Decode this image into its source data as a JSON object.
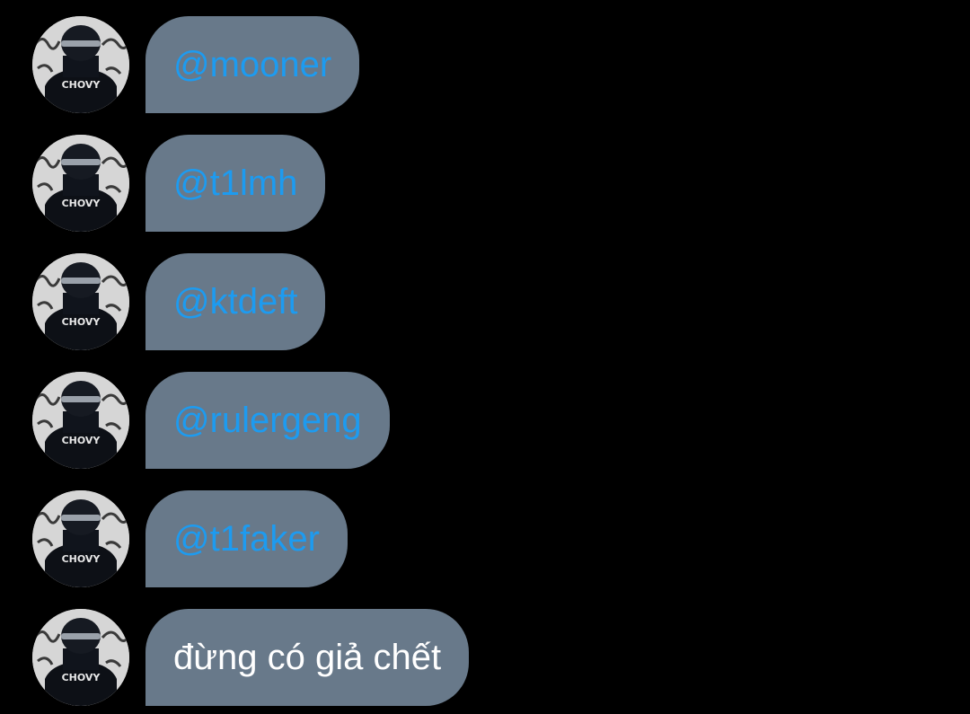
{
  "conversation": {
    "messages": [
      {
        "text": "@mooner",
        "kind": "mention",
        "avatar_icon": "profile-avatar"
      },
      {
        "text": "@t1lmh",
        "kind": "mention",
        "avatar_icon": "profile-avatar"
      },
      {
        "text": "@ktdeft",
        "kind": "mention",
        "avatar_icon": "profile-avatar"
      },
      {
        "text": "@rulergeng",
        "kind": "mention",
        "avatar_icon": "profile-avatar"
      },
      {
        "text": "@t1faker",
        "kind": "mention",
        "avatar_icon": "profile-avatar"
      },
      {
        "text": "đừng có giả chết",
        "kind": "plain",
        "avatar_icon": "profile-avatar"
      }
    ],
    "avatar_jersey_text": "CHOVY",
    "colors": {
      "background": "#000000",
      "bubble": "#68798a",
      "mention": "#1d9bf0",
      "plain_text": "#ffffff"
    }
  }
}
